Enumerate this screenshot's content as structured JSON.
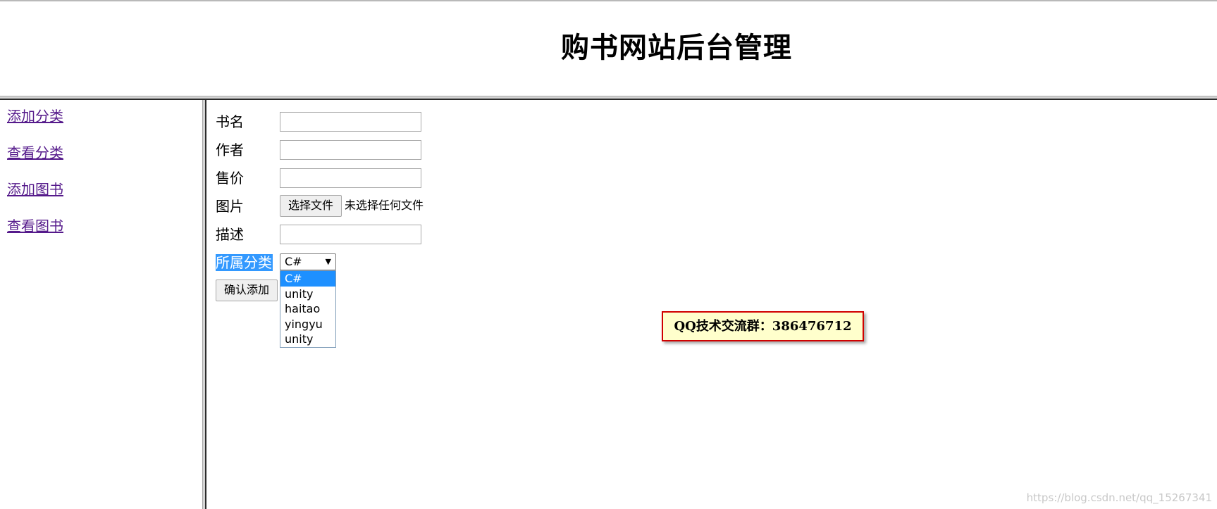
{
  "header": {
    "title": "购书网站后台管理"
  },
  "sidebar": {
    "items": [
      {
        "label": "添加分类"
      },
      {
        "label": "查看分类"
      },
      {
        "label": "添加图书"
      },
      {
        "label": "查看图书"
      }
    ]
  },
  "form": {
    "fields": [
      {
        "label": "书名",
        "value": ""
      },
      {
        "label": "作者",
        "value": ""
      },
      {
        "label": "售价",
        "value": ""
      },
      {
        "label": "图片"
      },
      {
        "label": "描述",
        "value": ""
      },
      {
        "label": "所属分类"
      }
    ],
    "file_button_label": "选择文件",
    "file_status": "未选择任何文件",
    "category": {
      "selected": "C#",
      "options": [
        "C#",
        "unity",
        "haitao",
        "yingyu",
        "unity"
      ]
    },
    "submit_label": "确认添加"
  },
  "overlay": {
    "qq_text": "QQ技术交流群：386476712"
  },
  "watermark": "https://blog.csdn.net/qq_15267341",
  "colors": {
    "link": "#551a8b",
    "selection": "#3399ff",
    "option_highlight": "#1e90ff",
    "badge_border": "#d00000",
    "badge_background": "#ffffcc"
  }
}
